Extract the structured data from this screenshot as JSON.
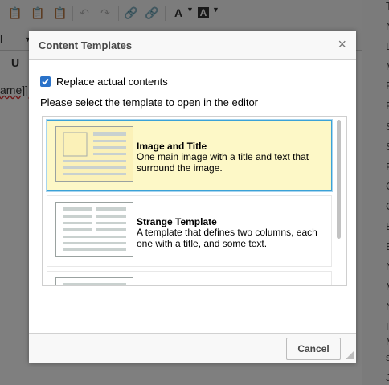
{
  "dialog": {
    "title": "Content Templates",
    "close_icon": "×",
    "replace_label": "Replace actual contents",
    "replace_checked": true,
    "instructions": "Please select the template to open in the editor",
    "templates": [
      {
        "name": "Image and Title",
        "description": "One main image with a title and text that surround the image.",
        "selected": true
      },
      {
        "name": "Strange Template",
        "description": "A template that defines two columns, each one with a title, and some text.",
        "selected": false
      }
    ],
    "cancel_label": "Cancel"
  },
  "background": {
    "text_snippet": "ame]],",
    "underline_glyph": "U",
    "row2_left": "l",
    "right_column_letters": [
      "T",
      "N",
      "D",
      "M",
      "F",
      "F",
      "S",
      "S",
      "F",
      "C",
      "C",
      "E",
      "E",
      "N",
      "M",
      "N",
      "L",
      "M",
      "s",
      "J"
    ],
    "toolbar_text_color_glyph": "A",
    "toolbar_bg_color_glyph": "A"
  },
  "colors": {
    "accent": "#2a72c9",
    "selected_bg": "#fdf8c7",
    "selected_border": "#3ba2d7"
  }
}
